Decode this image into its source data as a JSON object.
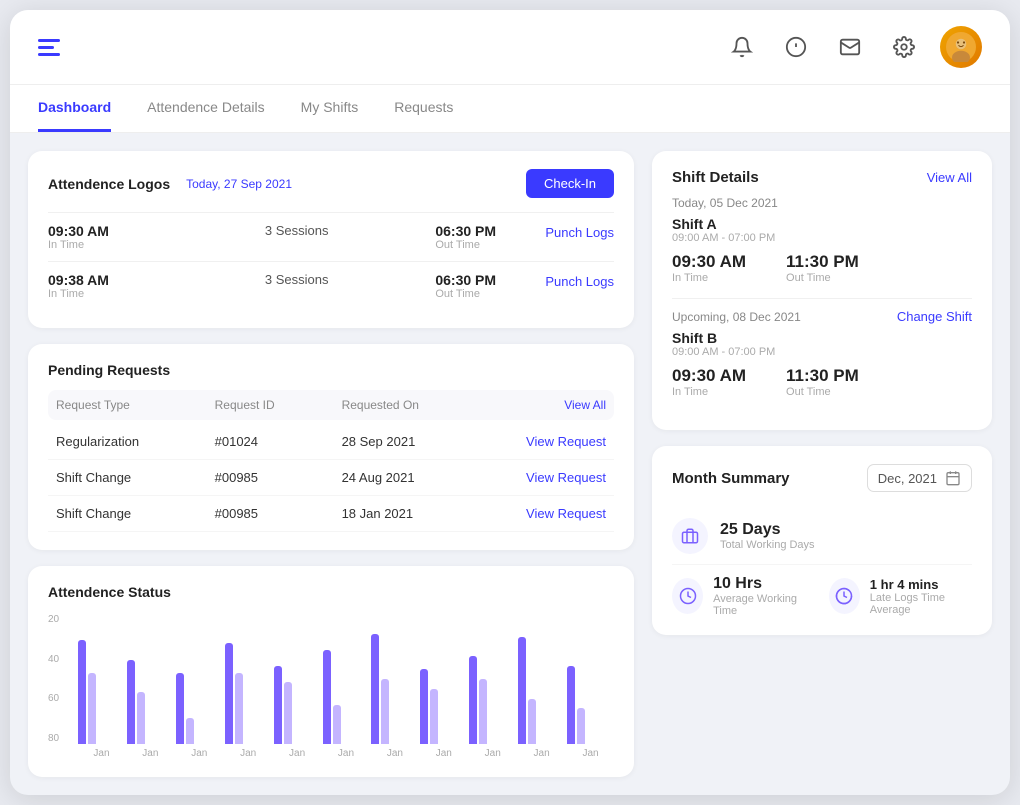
{
  "header": {
    "menu_icon": "≡",
    "icons": {
      "bell": "🔔",
      "message": "💬",
      "mail": "✉",
      "gear": "⚙"
    },
    "avatar_emoji": "👤"
  },
  "nav": {
    "tabs": [
      "Dashboard",
      "Attendence Details",
      "My Shifts",
      "Requests"
    ],
    "active_tab": "Dashboard"
  },
  "attendance": {
    "title": "Attendence Logos",
    "date": "Today, 27 Sep 2021",
    "check_in_label": "Check-In",
    "rows": [
      {
        "in_time": "09:30 AM",
        "in_label": "In Time",
        "sessions": "3 Sessions",
        "out_time": "06:30 PM",
        "out_label": "Out Time",
        "punch_logs": "Punch Logs"
      },
      {
        "in_time": "09:38 AM",
        "in_label": "In Time",
        "sessions": "3 Sessions",
        "out_time": "06:30 PM",
        "out_label": "Out Time",
        "punch_logs": "Punch Logs"
      }
    ]
  },
  "pending_requests": {
    "title": "Pending Requests",
    "columns": [
      "Request Type",
      "Request ID",
      "Requested On",
      "View All"
    ],
    "rows": [
      {
        "type": "Regularization",
        "id": "#01024",
        "date": "28 Sep 2021",
        "action": "View Request"
      },
      {
        "type": "Shift Change",
        "id": "#00985",
        "date": "24 Aug 2021",
        "action": "View Request"
      },
      {
        "type": "Shift Change",
        "id": "#00985",
        "date": "18 Jan 2021",
        "action": "View Request"
      }
    ]
  },
  "attendance_status": {
    "title": "Attendence Status",
    "y_labels": [
      "80",
      "60",
      "40",
      "20"
    ],
    "x_labels": [
      "Jan",
      "Jan",
      "Jan",
      "Jan",
      "Jan",
      "Jan",
      "Jan",
      "Jan",
      "Jan",
      "Jan",
      "Jan"
    ],
    "bars": [
      {
        "purple": 80,
        "violet": 55
      },
      {
        "purple": 65,
        "violet": 40
      },
      {
        "purple": 55,
        "violet": 20
      },
      {
        "purple": 78,
        "violet": 55
      },
      {
        "purple": 60,
        "violet": 48
      },
      {
        "purple": 72,
        "violet": 30
      },
      {
        "purple": 85,
        "violet": 50
      },
      {
        "purple": 58,
        "violet": 42
      },
      {
        "purple": 68,
        "violet": 50
      },
      {
        "purple": 82,
        "violet": 35
      },
      {
        "purple": 60,
        "violet": 28
      }
    ]
  },
  "shift_details": {
    "title": "Shift Details",
    "view_all": "View All",
    "today_date": "Today, 05 Dec 2021",
    "today_shift": {
      "name": "Shift A",
      "hours": "09:00 AM - 07:00 PM",
      "in_time": "09:30 AM",
      "in_label": "In Time",
      "out_time": "11:30 PM",
      "out_label": "Out Time"
    },
    "upcoming_date": "Upcoming, 08 Dec 2021",
    "change_shift": "Change Shift",
    "upcoming_shift": {
      "name": "Shift B",
      "hours": "09:00 AM - 07:00 PM",
      "in_time": "09:30 AM",
      "in_label": "In Time",
      "out_time": "11:30 PM",
      "out_label": "Out Time"
    }
  },
  "month_summary": {
    "title": "Month Summary",
    "month_picker_value": "Dec, 2021",
    "calendar_icon": "📅",
    "stats": {
      "working_days_value": "25 Days",
      "working_days_label": "Total Working Days",
      "working_time_value": "10 Hrs",
      "working_time_label": "Average Working Time",
      "late_logs_value": "1 hr 4 mins",
      "late_logs_label": "Late Logs Time Average"
    }
  }
}
